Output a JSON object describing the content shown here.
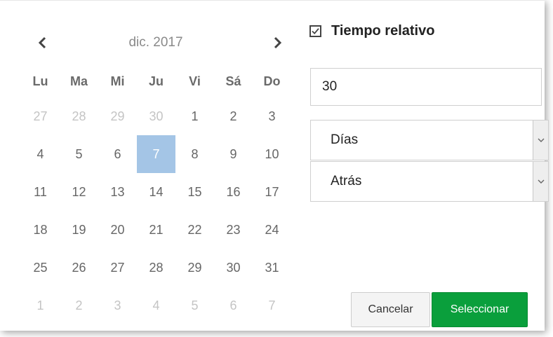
{
  "calendar": {
    "month_label": "dic. 2017",
    "prev_icon": "chevron-left-icon",
    "next_icon": "chevron-right-icon",
    "weekdays": [
      "Lu",
      "Ma",
      "Mi",
      "Ju",
      "Vi",
      "Sá",
      "Do"
    ],
    "weeks": [
      [
        {
          "d": "27",
          "o": true
        },
        {
          "d": "28",
          "o": true
        },
        {
          "d": "29",
          "o": true
        },
        {
          "d": "30",
          "o": true
        },
        {
          "d": "1"
        },
        {
          "d": "2"
        },
        {
          "d": "3"
        }
      ],
      [
        {
          "d": "4"
        },
        {
          "d": "5"
        },
        {
          "d": "6"
        },
        {
          "d": "7",
          "s": true
        },
        {
          "d": "8"
        },
        {
          "d": "9"
        },
        {
          "d": "10"
        }
      ],
      [
        {
          "d": "11"
        },
        {
          "d": "12"
        },
        {
          "d": "13"
        },
        {
          "d": "14"
        },
        {
          "d": "15"
        },
        {
          "d": "16"
        },
        {
          "d": "17"
        }
      ],
      [
        {
          "d": "18"
        },
        {
          "d": "19"
        },
        {
          "d": "20"
        },
        {
          "d": "21"
        },
        {
          "d": "22"
        },
        {
          "d": "23"
        },
        {
          "d": "24"
        }
      ],
      [
        {
          "d": "25"
        },
        {
          "d": "26"
        },
        {
          "d": "27"
        },
        {
          "d": "28"
        },
        {
          "d": "29"
        },
        {
          "d": "30"
        },
        {
          "d": "31"
        }
      ],
      [
        {
          "d": "1",
          "o": true
        },
        {
          "d": "2",
          "o": true
        },
        {
          "d": "3",
          "o": true
        },
        {
          "d": "4",
          "o": true
        },
        {
          "d": "5",
          "o": true
        },
        {
          "d": "6",
          "o": true
        },
        {
          "d": "7",
          "o": true
        }
      ]
    ],
    "selected_color": "#a4c5e6"
  },
  "relative": {
    "label": "Tiempo relativo",
    "checked": true,
    "amount": "30",
    "unit": "Días",
    "direction": "Atrás"
  },
  "buttons": {
    "cancel": "Cancelar",
    "select": "Seleccionar",
    "select_color": "#0a9f3c"
  }
}
